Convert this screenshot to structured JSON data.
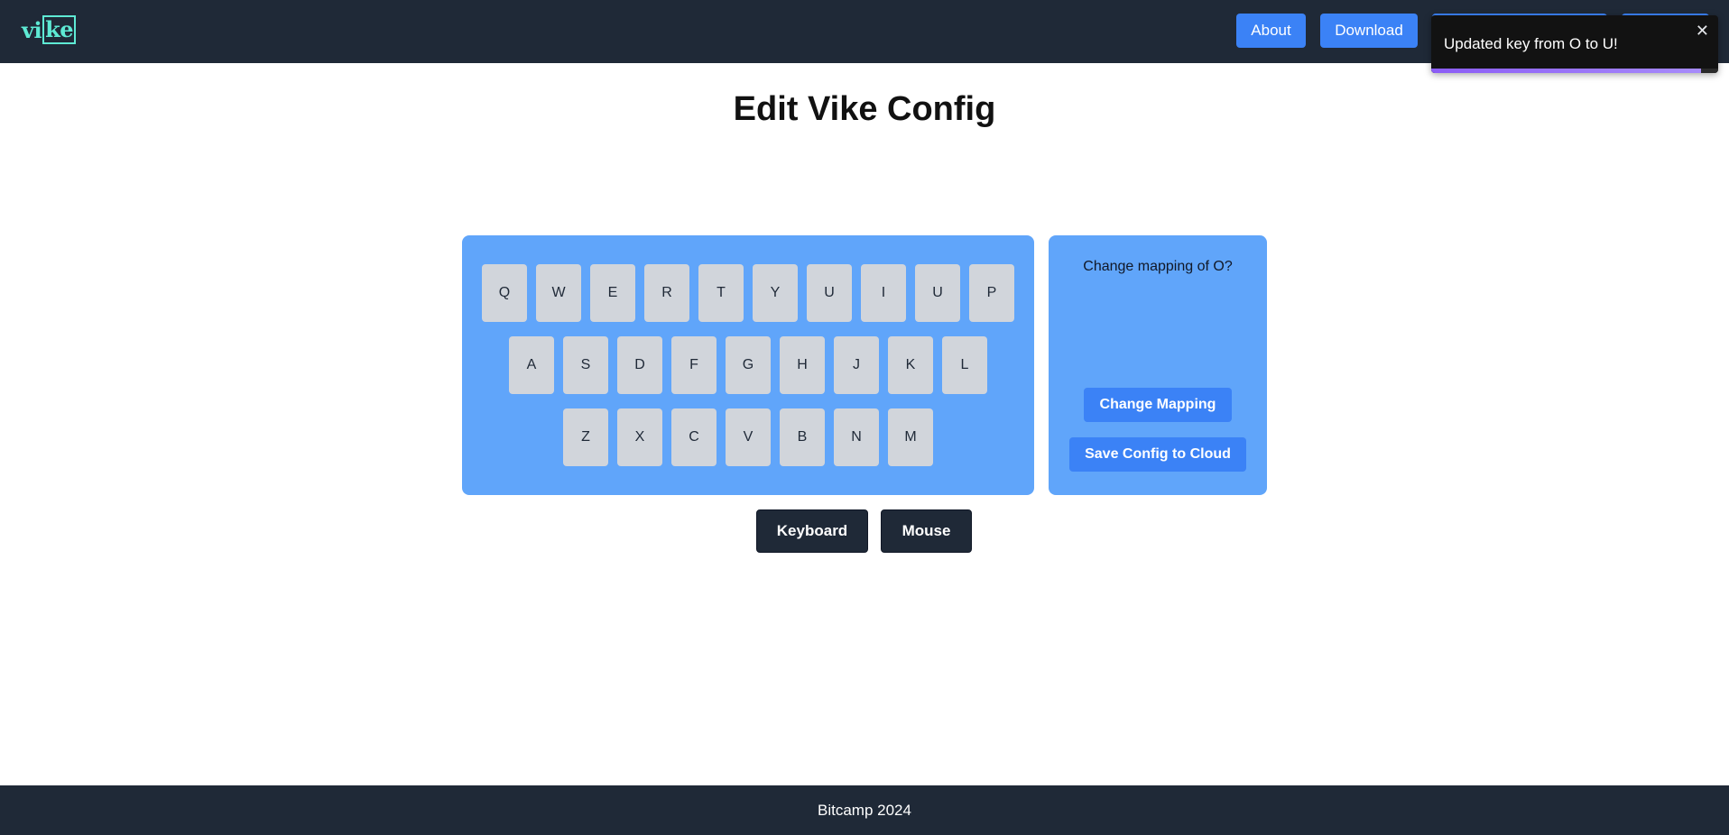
{
  "header": {
    "logo_text_a": "vi",
    "logo_text_b": "ke",
    "nav": [
      {
        "label": "About"
      },
      {
        "label": "Download"
      },
      {
        "label": ""
      },
      {
        "label": ""
      }
    ]
  },
  "toast": {
    "message": "Updated key from O to U!",
    "close_glyph": "✕",
    "progress_fraction": 0.94
  },
  "page": {
    "title": "Edit Vike Config"
  },
  "keyboard": {
    "rows": [
      [
        "Q",
        "W",
        "E",
        "R",
        "T",
        "Y",
        "U",
        "I",
        "U",
        "P"
      ],
      [
        "A",
        "S",
        "D",
        "F",
        "G",
        "H",
        "J",
        "K",
        "L"
      ],
      [
        "Z",
        "X",
        "C",
        "V",
        "B",
        "N",
        "M"
      ]
    ]
  },
  "mapping_panel": {
    "question": "Change mapping of O?",
    "change_button": "Change Mapping",
    "save_button": "Save Config to Cloud"
  },
  "mode_buttons": {
    "keyboard": "Keyboard",
    "mouse": "Mouse"
  },
  "footer": {
    "text": "Bitcamp 2024"
  },
  "colors": {
    "header_bg": "#1f2937",
    "accent": "#3b82f6",
    "panel": "#60a5fa",
    "key": "#d1d5db",
    "logo": "#5eead4",
    "toast_bg": "#121212",
    "toast_progress": "#8b5cf6"
  }
}
